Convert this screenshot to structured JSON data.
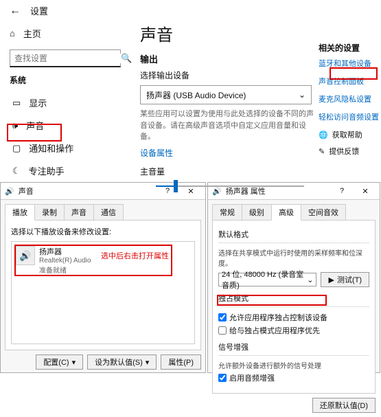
{
  "settings": {
    "title": "设置",
    "home": "主页",
    "search_placeholder": "查找设置",
    "section": "系统",
    "nav": [
      {
        "icon": "▭",
        "label": "显示"
      },
      {
        "icon": "🔊",
        "label": "声音"
      },
      {
        "icon": "▢",
        "label": "通知和操作"
      },
      {
        "icon": "☾",
        "label": "专注助手"
      }
    ]
  },
  "page": {
    "title": "声音",
    "output_heading": "输出",
    "choose_device": "选择输出设备",
    "device_selected": "扬声器 (USB Audio Device)",
    "desc": "某些应用可以设置为使用与此处选择的设备不同的声音设备。请在高级声音选项中自定义应用音量和设备。",
    "device_props": "设备属性",
    "volume_label": "主音量",
    "volume_value": "12"
  },
  "related": {
    "heading": "相关的设置",
    "links": [
      "蓝牙和其他设备",
      "声音控制面板",
      "麦克风隐私设置",
      "轻松访问音频设置"
    ],
    "help": "获取帮助",
    "feedback": "提供反馈"
  },
  "sound_dialog": {
    "title": "声音",
    "tabs": [
      "播放",
      "录制",
      "声音",
      "通信"
    ],
    "list_label": "选择以下播放设备来修改设置:",
    "device": {
      "name": "扬声器",
      "sub1": "Realtek(R) Audio",
      "sub2": "准备就绪"
    },
    "note": "选中后右击打开属性",
    "configure": "配置(C)",
    "set_default": "设为默认值(S)",
    "properties": "属性(P)"
  },
  "speaker_dialog": {
    "title": "扬声器 属性",
    "tabs": [
      "常规",
      "级别",
      "高级",
      "空间音效"
    ],
    "default_format": "默认格式",
    "default_desc": "选择在共享模式中运行时使用的采样频率和位深度。",
    "format_value": "24 位, 48000 Hz (录音室音质)",
    "test": "测试(T)",
    "exclusive_heading": "独占模式",
    "cb1": "允许应用程序独占控制该设备",
    "cb2": "给与独占模式应用程序优先",
    "enhance_heading": "信号增强",
    "enhance_desc": "允许额外设备进行额外的信号处理",
    "cb3": "启用音频增强",
    "restore": "还原默认值(D)"
  }
}
